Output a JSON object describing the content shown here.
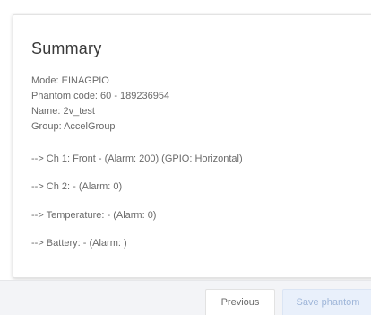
{
  "summary": {
    "title": "Summary",
    "mode": "Mode: EINAGPIO",
    "phantom_code": "Phantom code: 60 - 189236954",
    "name": "Name: 2v_test",
    "group": "Group: AccelGroup",
    "channels": [
      "--> Ch 1: Front - (Alarm: 200) (GPIO: Horizontal)",
      "--> Ch 2: - (Alarm: 0)",
      "--> Temperature: - (Alarm: 0)",
      "--> Battery: - (Alarm: )"
    ]
  },
  "buttons": {
    "previous_label": "Previous",
    "save_label": "Save phantom"
  }
}
